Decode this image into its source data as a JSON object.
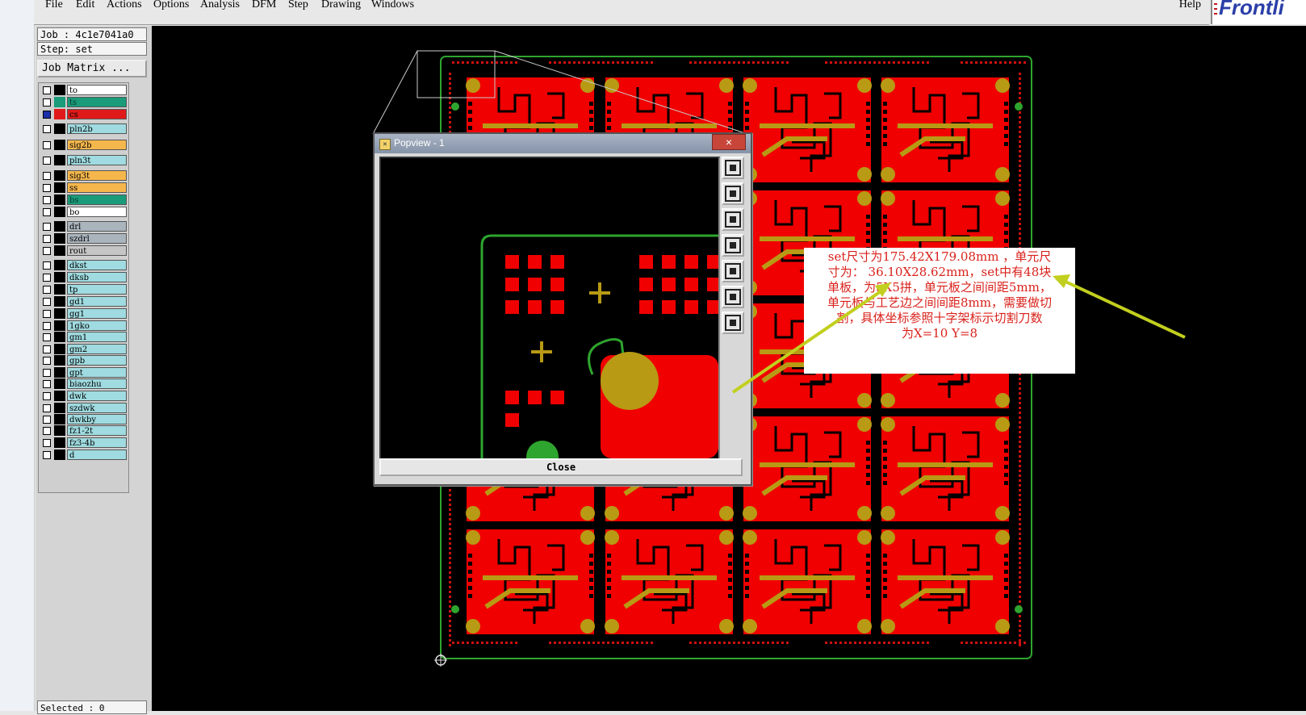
{
  "menu": {
    "items": [
      {
        "label": "File"
      },
      {
        "label": "Edit"
      },
      {
        "label": "Actions"
      },
      {
        "label": "Options"
      },
      {
        "label": "Analysis"
      },
      {
        "label": "DFM"
      },
      {
        "label": "Step"
      },
      {
        "label": "Drawing"
      },
      {
        "label": "Windows"
      }
    ],
    "help": "Help",
    "brand": "Frontli"
  },
  "panel": {
    "job": "Job : 4c1e7041a0",
    "step": "Step: set",
    "job_matrix": "Job Matrix ...",
    "selected": "Selected : 0"
  },
  "layers": [
    {
      "name": "to",
      "color": "#ffffff"
    },
    {
      "name": "ts",
      "color": "#1a9b7a"
    },
    {
      "name": "cs",
      "color": "#e01a1a",
      "active": true
    },
    {
      "name": "pln2b",
      "color": "#9fdbe0"
    },
    {
      "name": "sig2b",
      "color": "#f5b74c"
    },
    {
      "name": "pln3t",
      "color": "#9fdbe0"
    },
    {
      "name": "sig3t",
      "color": "#f5b74c"
    },
    {
      "name": "ss",
      "color": "#f5b74c"
    },
    {
      "name": "bs",
      "color": "#1a9b7a"
    },
    {
      "name": "bo",
      "color": "#ffffff"
    },
    {
      "name": "drl",
      "color": "#aab4bd"
    },
    {
      "name": "szdrl",
      "color": "#aab4bd"
    },
    {
      "name": "rout",
      "color": "#c5c5c5"
    },
    {
      "name": "dkst",
      "color": "#9fdbe0"
    },
    {
      "name": "dksb",
      "color": "#9fdbe0"
    },
    {
      "name": "tp",
      "color": "#9fdbe0"
    },
    {
      "name": "gd1",
      "color": "#9fdbe0"
    },
    {
      "name": "gg1",
      "color": "#9fdbe0"
    },
    {
      "name": "1gko",
      "color": "#9fdbe0"
    },
    {
      "name": "gm1",
      "color": "#9fdbe0"
    },
    {
      "name": "gm2",
      "color": "#9fdbe0"
    },
    {
      "name": "gpb",
      "color": "#9fdbe0"
    },
    {
      "name": "gpt",
      "color": "#9fdbe0"
    },
    {
      "name": "biaozhu",
      "color": "#9fdbe0"
    },
    {
      "name": "dwk",
      "color": "#9fdbe0"
    },
    {
      "name": "szdwk",
      "color": "#9fdbe0"
    },
    {
      "name": "dwkby",
      "color": "#9fdbe0"
    },
    {
      "name": "fz1-2t",
      "color": "#9fdbe0"
    },
    {
      "name": "fz3-4b",
      "color": "#9fdbe0"
    },
    {
      "name": "d",
      "color": "#9fdbe0"
    }
  ],
  "popup": {
    "title": "Popview - 1",
    "close_x": "×",
    "close_label": "Close",
    "tools": [
      "zoom-window-icon",
      "pan-up-icon",
      "pan-down-icon",
      "pan-left-icon",
      "pan-right-icon",
      "zoom-fit-icon",
      "zoom-home-icon"
    ]
  },
  "note": {
    "lines": [
      "set尺寸为175.42X179.08mm ，单元尺",
      "寸为： 36.10X28.62mm，set中有48块",
      "单板，为5X5拼，单元板之间间距5mm，",
      "单元板与工艺边之间间距8mm，需要做切",
      "割，具体坐标参照十字架标示切割刀数",
      "为X=10  Y=8"
    ]
  },
  "colors": {
    "pcb_red": "#f00000",
    "pad_gold": "#b89a14",
    "outline_green": "#2ea52e",
    "annotation_arrow": "#c2cf1e",
    "note_text": "#d9221c"
  }
}
